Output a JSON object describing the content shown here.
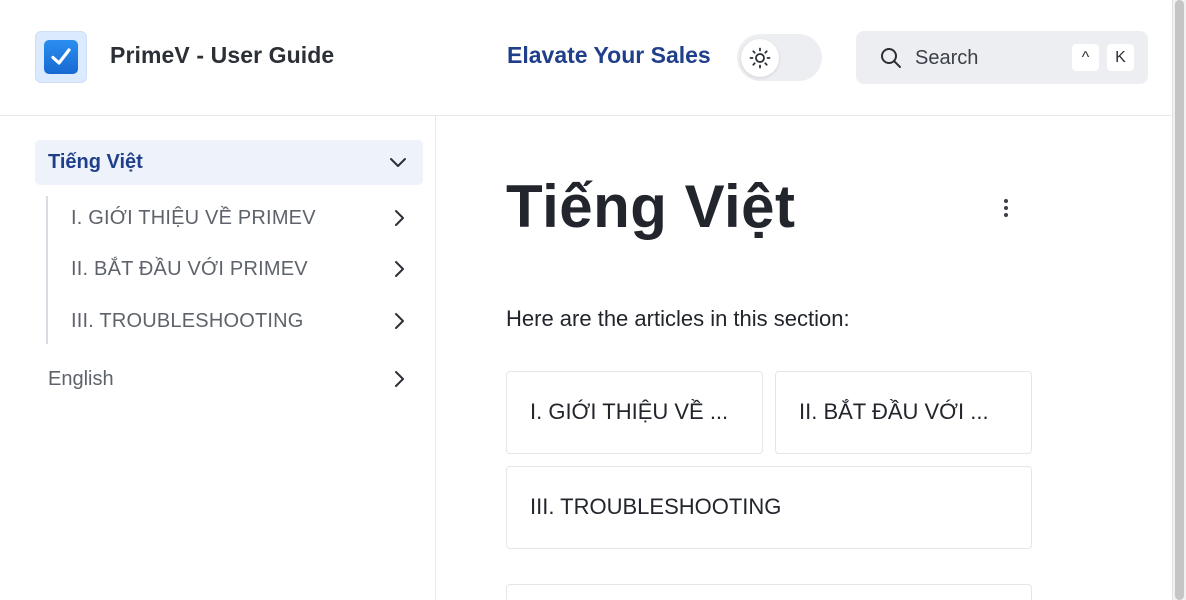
{
  "header": {
    "site_title": "PrimeV - User Guide",
    "tagline": "Elavate Your Sales",
    "logo_icon": "checkbox-icon",
    "theme_toggle_icon": "sun-icon",
    "search": {
      "placeholder": "Search",
      "shortcut_keys": [
        "^",
        "K"
      ]
    }
  },
  "sidebar": {
    "active": {
      "label": "Tiếng Việt",
      "icon": "chevron-down-icon"
    },
    "sub_items": [
      {
        "label": "I. GIỚI THIỆU VỀ PRIMEV"
      },
      {
        "label": "II. BẮT ĐẦU VỚI PRIMEV"
      },
      {
        "label": "III. TROUBLESHOOTING"
      }
    ],
    "other": {
      "label": "English"
    }
  },
  "main": {
    "title": "Tiếng Việt",
    "intro": "Here are the articles in this section:",
    "cards": [
      {
        "label": "I. GIỚI THIỆU VỀ ..."
      },
      {
        "label": "II. BẮT ĐẦU VỚI ..."
      },
      {
        "label": "III. TROUBLESHOOTING"
      }
    ]
  },
  "colors": {
    "accent": "#1f3f8a",
    "active_bg": "#eef2fb",
    "search_bg": "#eceef1",
    "border": "#e6e8eb"
  }
}
